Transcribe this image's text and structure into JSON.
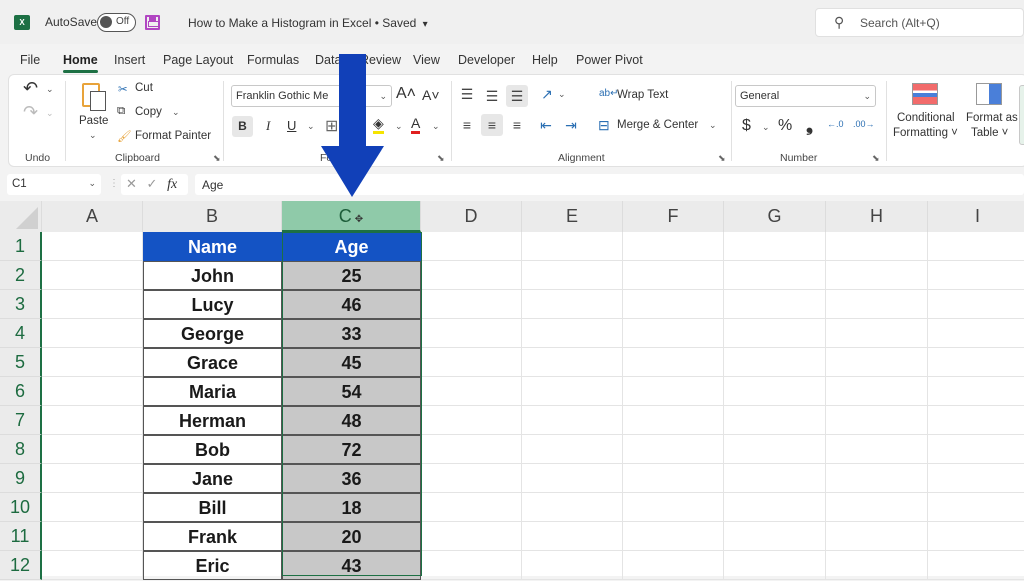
{
  "titlebar": {
    "app_icon": "excel-logo-icon",
    "autosave_label": "AutoSave",
    "autosave_state": "Off",
    "save_icon": "save-icon",
    "document_title": "How to Make a Histogram in Excel • Saved",
    "title_chevron": "▾",
    "search_icon": "⌕",
    "search_placeholder": "Search (Alt+Q)"
  },
  "tabs": [
    "File",
    "Home",
    "Insert",
    "Page Layout",
    "Formulas",
    "Data",
    "Review",
    "View",
    "Developer",
    "Help",
    "Power Pivot"
  ],
  "active_tab": "Home",
  "ribbon": {
    "undo": {
      "undo_icon": "↶",
      "redo_icon": "↷",
      "chev": "⌄",
      "label": "Undo"
    },
    "clipboard": {
      "paste": "Paste",
      "cut": "Cut",
      "copy": "Copy",
      "format_painter": "Format Painter",
      "label": "Clipboard"
    },
    "font": {
      "font_name": "Franklin Gothic Me",
      "bold": "B",
      "italic": "I",
      "underline": "U",
      "increase": "A˄",
      "decrease": "A˅",
      "label": "Font",
      "font_color": "#e02020",
      "fill_color": "#f5e400"
    },
    "alignment": {
      "wrap_text": "Wrap Text",
      "merge_center": "Merge & Center",
      "label": "Alignment"
    },
    "number": {
      "format": "General",
      "currency": "$",
      "percent": "%",
      "comma": "❟",
      "inc_decimal": "←.0",
      "dec_decimal": ".00→",
      "label": "Number"
    },
    "styles": {
      "conditional_formatting_1": "Conditional",
      "conditional_formatting_2": "Formatting ˅",
      "format_as_table_1": "Format as",
      "format_as_table_2": "Table ˅"
    },
    "launcher_icon": "⬊"
  },
  "formula_bar": {
    "name_box": "C1",
    "name_chev": "⌄",
    "cancel_icon": "✕",
    "enter_icon": "✓",
    "fx_label": "fx",
    "formula": "Age"
  },
  "grid": {
    "columns": [
      "A",
      "B",
      "C",
      "D",
      "E",
      "F",
      "G",
      "H",
      "I"
    ],
    "selected_column": "C",
    "rows": [
      "1",
      "2",
      "3",
      "4",
      "5",
      "6",
      "7",
      "8",
      "9",
      "10",
      "11",
      "12"
    ],
    "table_header": {
      "name": "Name",
      "age": "Age"
    },
    "records": [
      {
        "name": "John",
        "age": "25"
      },
      {
        "name": "Lucy",
        "age": "46"
      },
      {
        "name": "George",
        "age": "33"
      },
      {
        "name": "Grace",
        "age": "45"
      },
      {
        "name": "Maria",
        "age": "54"
      },
      {
        "name": "Herman",
        "age": "48"
      },
      {
        "name": "Bob",
        "age": "72"
      },
      {
        "name": "Jane",
        "age": "36"
      },
      {
        "name": "Bill",
        "age": "18"
      },
      {
        "name": "Frank",
        "age": "20"
      },
      {
        "name": "Eric",
        "age": "43"
      }
    ]
  },
  "annotation": {
    "arrow_color": "#1140b8",
    "points_to": "column C"
  },
  "colors": {
    "accent": "#1d7044",
    "table_header": "#1453c4",
    "selected_cells": "#c8c8c8",
    "selected_col_header": "#8fcaa9"
  }
}
